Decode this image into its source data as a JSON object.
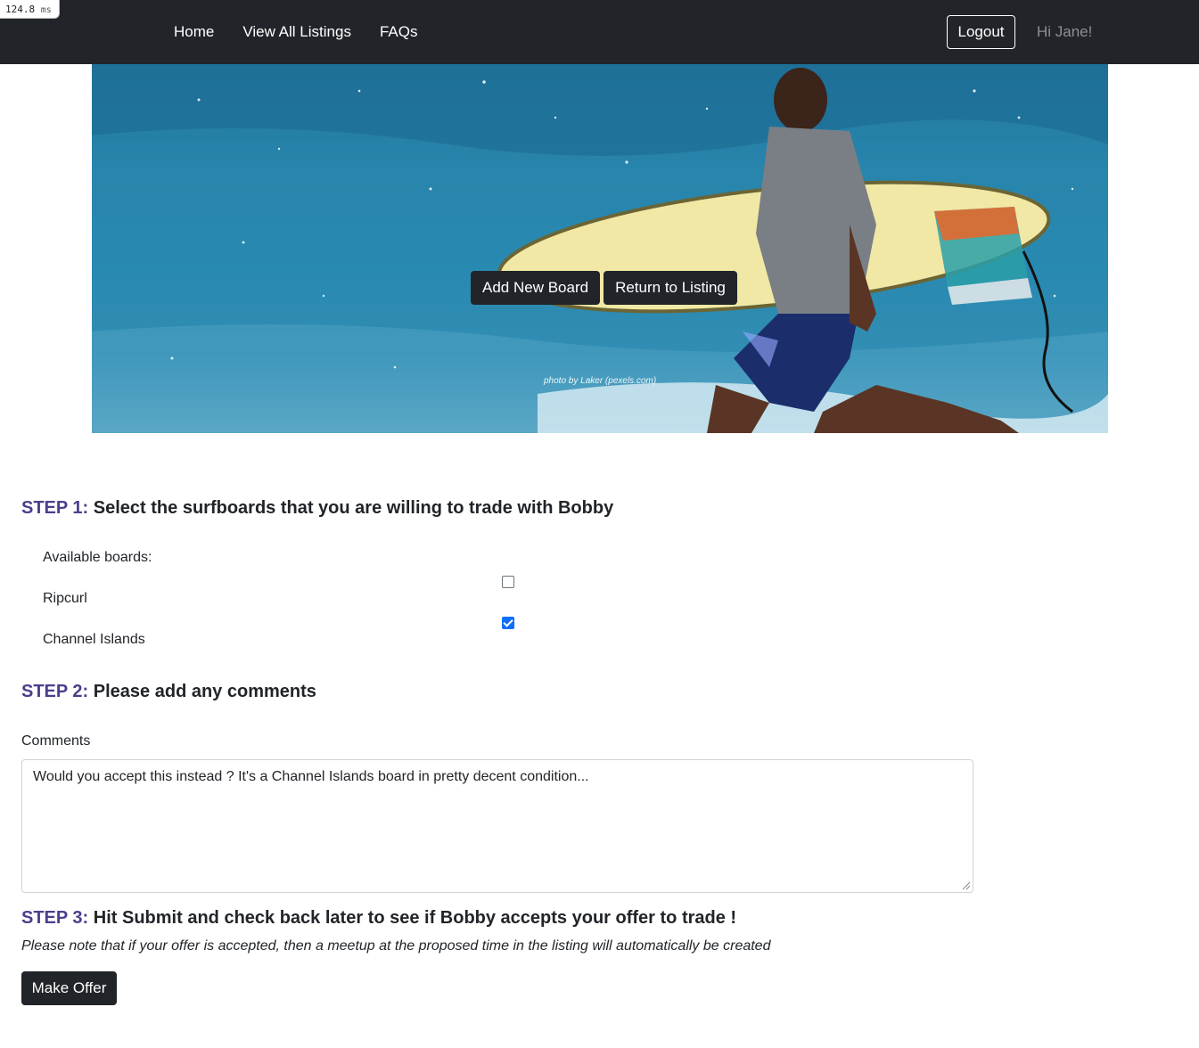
{
  "timing": {
    "value": "124.8",
    "unit": "ms"
  },
  "nav": {
    "links": [
      "Home",
      "View All Listings",
      "FAQs"
    ],
    "logout_label": "Logout",
    "greeting": "Hi Jane!"
  },
  "hero": {
    "add_board_label": "Add New Board",
    "return_label": "Return to Listing",
    "photo_credit": "photo by Laker (pexels.com)"
  },
  "step1": {
    "label": "STEP 1:",
    "text": "Select the surfboards that you are willing to trade with Bobby",
    "available_label": "Available boards:",
    "boards": [
      {
        "name": "Ripcurl",
        "checked": false
      },
      {
        "name": "Channel Islands",
        "checked": true
      }
    ]
  },
  "step2": {
    "label": "STEP 2:",
    "text": "Please add any comments",
    "comments_label": "Comments",
    "comments_value": "Would you accept this instead ? It's a Channel Islands board in pretty decent condition..."
  },
  "step3": {
    "label": "STEP 3:",
    "text": "Hit Submit and check back later to see if Bobby accepts your offer to trade !",
    "note": "Please note that if your offer is accepted, then a meetup at the proposed time in the listing will automatically be created",
    "submit_label": "Make Offer"
  },
  "colors": {
    "navbar_bg": "#212529",
    "step_label": "#4a3f8c",
    "checkbox_checked": "#0d6efd"
  }
}
